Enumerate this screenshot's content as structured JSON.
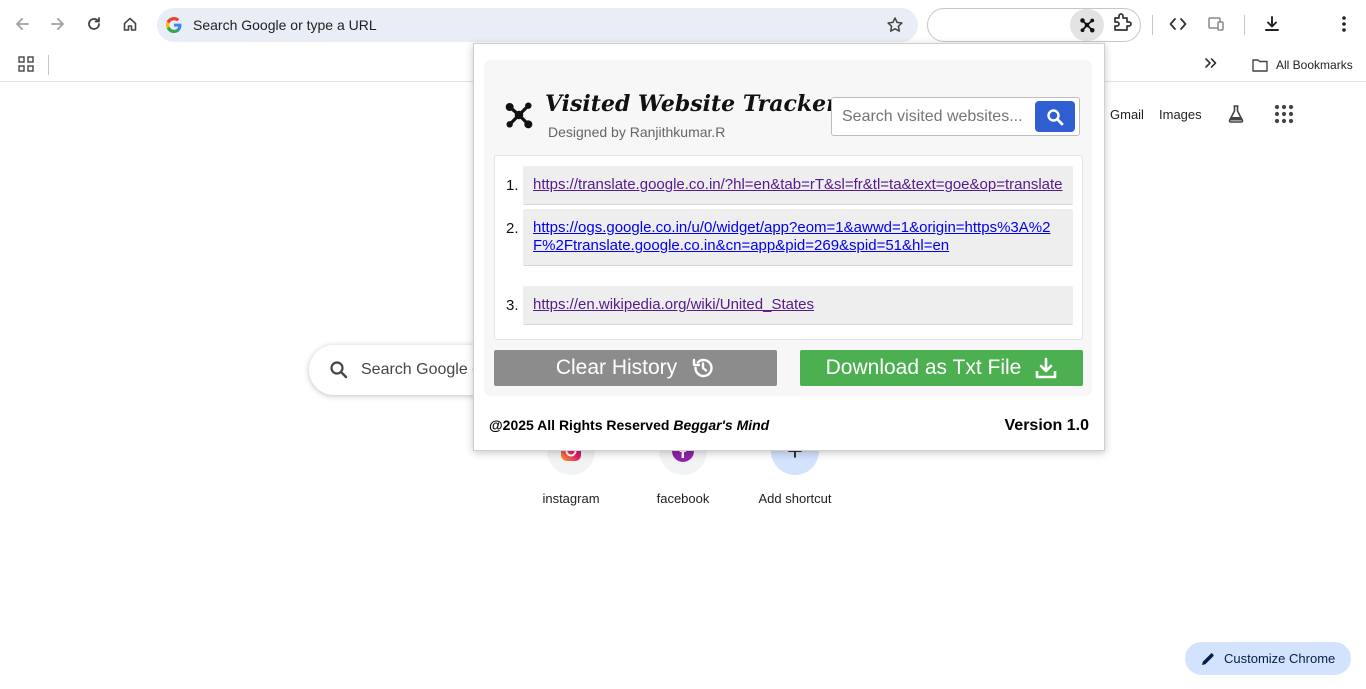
{
  "browser": {
    "omnibox_placeholder": "Search Google or type a URL",
    "bookmarks": {
      "folder_label": "All Bookmarks"
    }
  },
  "ntp": {
    "links": [
      "Gmail",
      "Images"
    ],
    "search_placeholder": "Search Google o",
    "shortcuts": [
      {
        "label": "instagram",
        "icon": "instagram-icon"
      },
      {
        "label": "facebook",
        "icon": "facebook-icon"
      },
      {
        "label": "Add shortcut",
        "icon": "plus-icon"
      }
    ],
    "customize_label": "Customize Chrome"
  },
  "popup": {
    "title": "Visited Website Tracker",
    "subtitle": "Designed by Ranjithkumar.R",
    "search_placeholder": "Search visited websites...",
    "history": [
      {
        "num": "1.",
        "url": "https://translate.google.co.in/?hl=en&tab=rT&sl=fr&tl=ta&text=goe&op=translate",
        "visited": true
      },
      {
        "num": "2.",
        "url": "https://ogs.google.co.in/u/0/widget/app?eom=1&awwd=1&origin=https%3A%2F%2Ftranslate.google.co.in&cn=app&pid=269&spid=51&hl=en",
        "visited": false
      },
      {
        "num": "3.",
        "url": "https://en.wikipedia.org/wiki/United_States",
        "visited": true
      }
    ],
    "clear_label": "Clear History",
    "download_label": "Download as Txt File",
    "footer_rights": "@2025 All Rights Reserved",
    "footer_brand": "Beggar's Mind",
    "version": "Version 1.0"
  },
  "colors": {
    "omnibox_bg": "#e9eef6",
    "search_button": "#2f5fd0",
    "clear_button": "#8c8c8c",
    "download_button": "#4caf50",
    "visited_link": "#551a8b",
    "fresh_link": "#0000ee",
    "customize_bg": "#d3e3fd"
  }
}
